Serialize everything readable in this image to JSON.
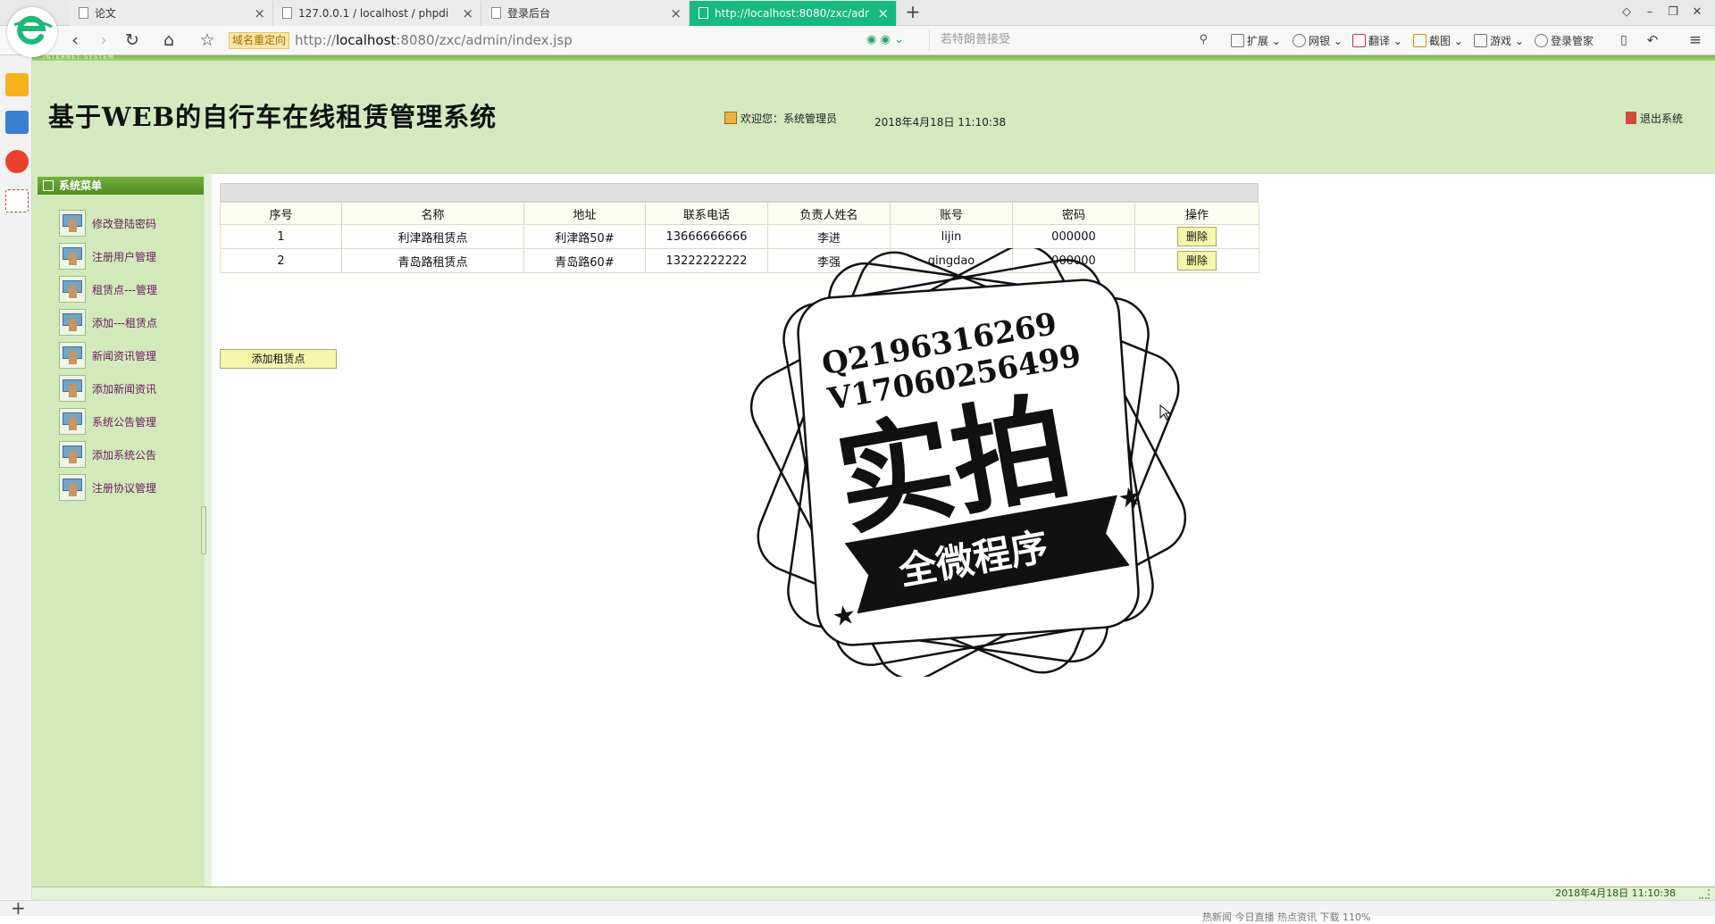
{
  "browser": {
    "tabs": [
      {
        "label": "论文",
        "active": false
      },
      {
        "label": "127.0.0.1 / localhost / phpdi",
        "active": false
      },
      {
        "label": "登录后台",
        "active": false
      },
      {
        "label": "http://localhost:8080/zxc/adr",
        "active": true
      }
    ],
    "new_tab": "+",
    "redirect_badge": "域名重定向",
    "url_prefix": "http://",
    "url_host": "localhost",
    "url_rest": ":8080/zxc/admin/index.jsp",
    "search_placeholder": "若特朗普接受",
    "tools": [
      "扩展",
      "网银",
      "翻译",
      "截图",
      "游戏",
      "登录管家"
    ]
  },
  "header": {
    "small_text": "INTERNET SYSTEM",
    "title": "基于WEB的自行车在线租赁管理系统",
    "welcome": "欢迎您：系统管理员",
    "datetime": "2018年4月18日 11:10:38",
    "logout": "退出系统"
  },
  "sidebar": {
    "title": "系统菜单",
    "items": [
      "修改登陆密码",
      "注册用户管理",
      "租赁点---管理",
      "添加---租赁点",
      "新闻资讯管理",
      "添加新闻资讯",
      "系统公告管理",
      "添加系统公告",
      "注册协议管理"
    ]
  },
  "table": {
    "headers": [
      "序号",
      "名称",
      "地址",
      "联系电话",
      "负责人姓名",
      "账号",
      "密码",
      "操作"
    ],
    "rows": [
      {
        "no": "1",
        "name": "利津路租赁点",
        "address": "利津路50#",
        "phone": "13666666666",
        "manager": "李进",
        "account": "lijin",
        "password": "000000",
        "action": "删除"
      },
      {
        "no": "2",
        "name": "青岛路租赁点",
        "address": "青岛路60#",
        "phone": "13222222222",
        "manager": "李强",
        "account": "qingdao",
        "password": "000000",
        "action": "删除"
      }
    ],
    "add_button": "添加租赁点"
  },
  "stamp": {
    "line1": "Q2196316269",
    "line2": "V17060256499",
    "big": "实拍",
    "banner": "全微程序"
  },
  "footer": {
    "datetime": "2018年4月18日 11:10:38"
  },
  "statusbar": {
    "items": "热新闻   今日直播   热点资讯   下载   110%"
  }
}
